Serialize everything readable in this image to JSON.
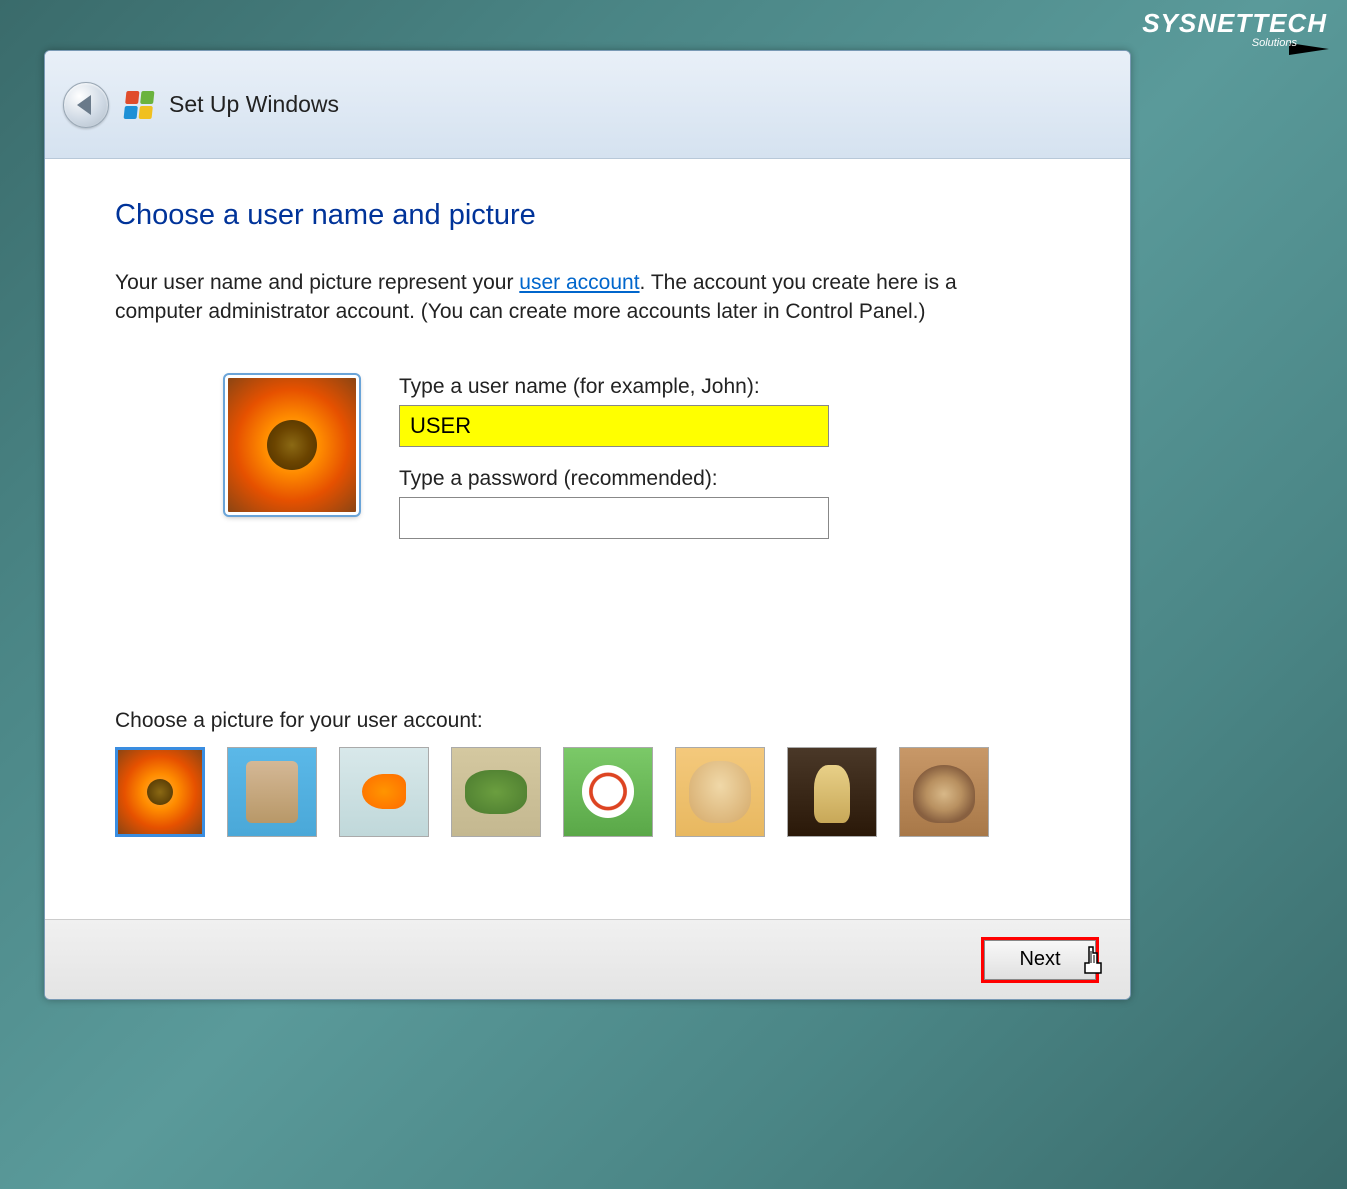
{
  "watermark": {
    "brand": "SYSNETTECH",
    "sub": "Solutions"
  },
  "titlebar": {
    "title": "Set Up Windows"
  },
  "main": {
    "heading": "Choose a user name and picture",
    "desc_before": "Your user name and picture represent your ",
    "desc_link": "user account",
    "desc_after": ". The account you create here is a computer administrator account. (You can create more accounts later in Control Panel.)",
    "username_label": "Type a user name (for example, John):",
    "username_value": "USER",
    "password_label": "Type a password (recommended):",
    "password_value": "",
    "picker_label": "Choose a picture for your user account:"
  },
  "avatars": [
    {
      "name": "flower",
      "selected": true
    },
    {
      "name": "robot",
      "selected": false
    },
    {
      "name": "fish",
      "selected": false
    },
    {
      "name": "frog",
      "selected": false
    },
    {
      "name": "soccer-ball",
      "selected": false
    },
    {
      "name": "dog",
      "selected": false
    },
    {
      "name": "chess",
      "selected": false
    },
    {
      "name": "cat",
      "selected": false
    }
  ],
  "footer": {
    "next_label": "Next"
  }
}
